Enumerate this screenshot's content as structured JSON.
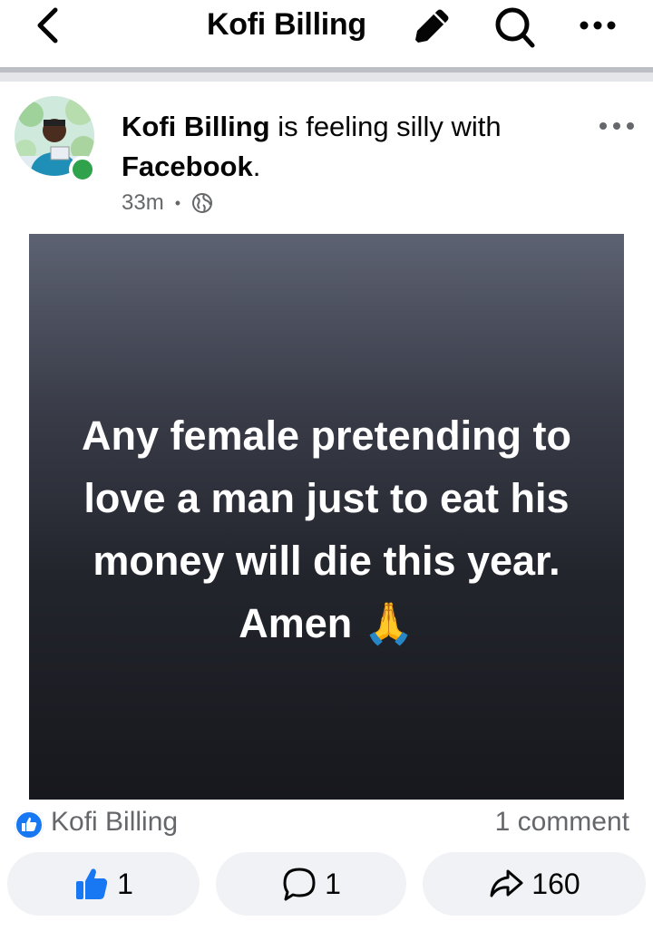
{
  "header": {
    "title": "Kofi Billing",
    "back_icon": "chevron-left-icon",
    "edit_icon": "pencil-icon",
    "search_icon": "search-icon",
    "more_icon": "more-horizontal-icon"
  },
  "post": {
    "author": "Kofi Billing",
    "feeling_text": " is feeling silly with ",
    "tagged": "Facebook",
    "tagged_suffix": ".",
    "time": "33m",
    "separator": "•",
    "audience_icon": "globe-icon",
    "online": true,
    "media_text_lines": [
      "Any female pretending to",
      "love a man just to eat his",
      "money will die this year.",
      "Amen 🙏"
    ],
    "colors": {
      "online_dot": "#31a24c",
      "like_blue": "#1877f2",
      "secondary_text": "#65676b",
      "pill_bg": "#f0f2f5"
    }
  },
  "reactions": {
    "reacted_by": "Kofi Billing",
    "comments_label": "1 comment"
  },
  "actions": {
    "like_count": "1",
    "comment_count": "1",
    "share_count": "160"
  }
}
